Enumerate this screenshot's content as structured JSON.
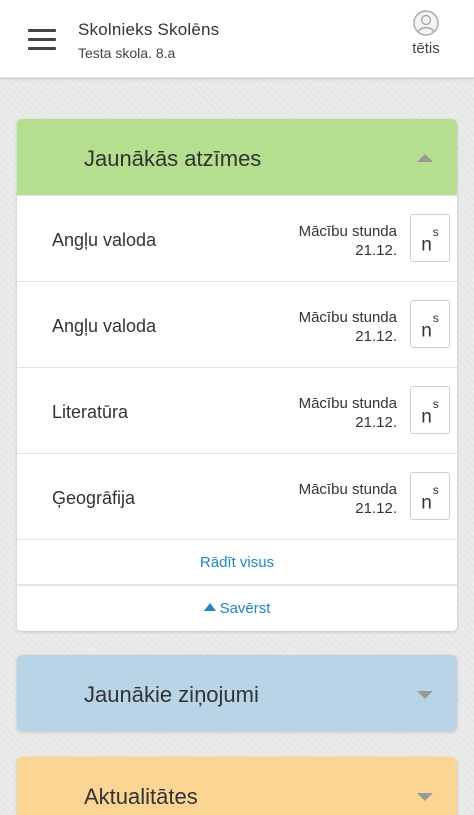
{
  "header": {
    "user_name": "Skolnieks Skolēns",
    "school_class": "Testa skola. 8.a",
    "profile_label": "tētis"
  },
  "colors": {
    "grades_header": "#b3df8e",
    "messages_header": "#b8d4e6",
    "news_header": "#fbd593",
    "link": "#1f86c6"
  },
  "grades_card": {
    "title": "Jaunākās atzīmes",
    "rows": [
      {
        "subject": "Angļu valoda",
        "type": "Mācību stunda",
        "date": "21.12.",
        "grade": "n",
        "grade_sup": "s"
      },
      {
        "subject": "Angļu valoda",
        "type": "Mācību stunda",
        "date": "21.12.",
        "grade": "n",
        "grade_sup": "s"
      },
      {
        "subject": "Literatūra",
        "type": "Mācību stunda",
        "date": "21.12.",
        "grade": "n",
        "grade_sup": "s"
      },
      {
        "subject": "Ģeogrāfija",
        "type": "Mācību stunda",
        "date": "21.12.",
        "grade": "n",
        "grade_sup": "s"
      }
    ],
    "show_all_label": "Rādīt visus",
    "collapse_label": "Savērst"
  },
  "messages_card": {
    "title": "Jaunākie ziņojumi"
  },
  "news_card": {
    "title": "Aktualitātes"
  }
}
